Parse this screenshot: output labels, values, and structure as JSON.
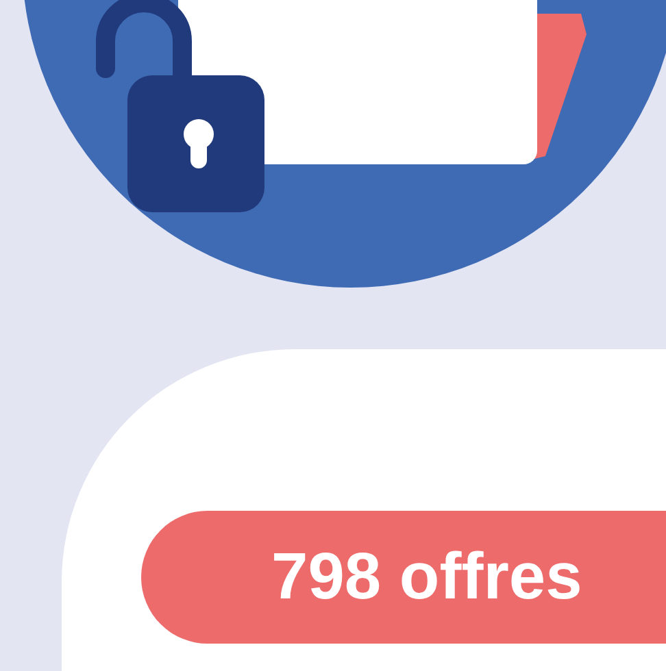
{
  "offers_badge": {
    "text": "798 offres"
  }
}
